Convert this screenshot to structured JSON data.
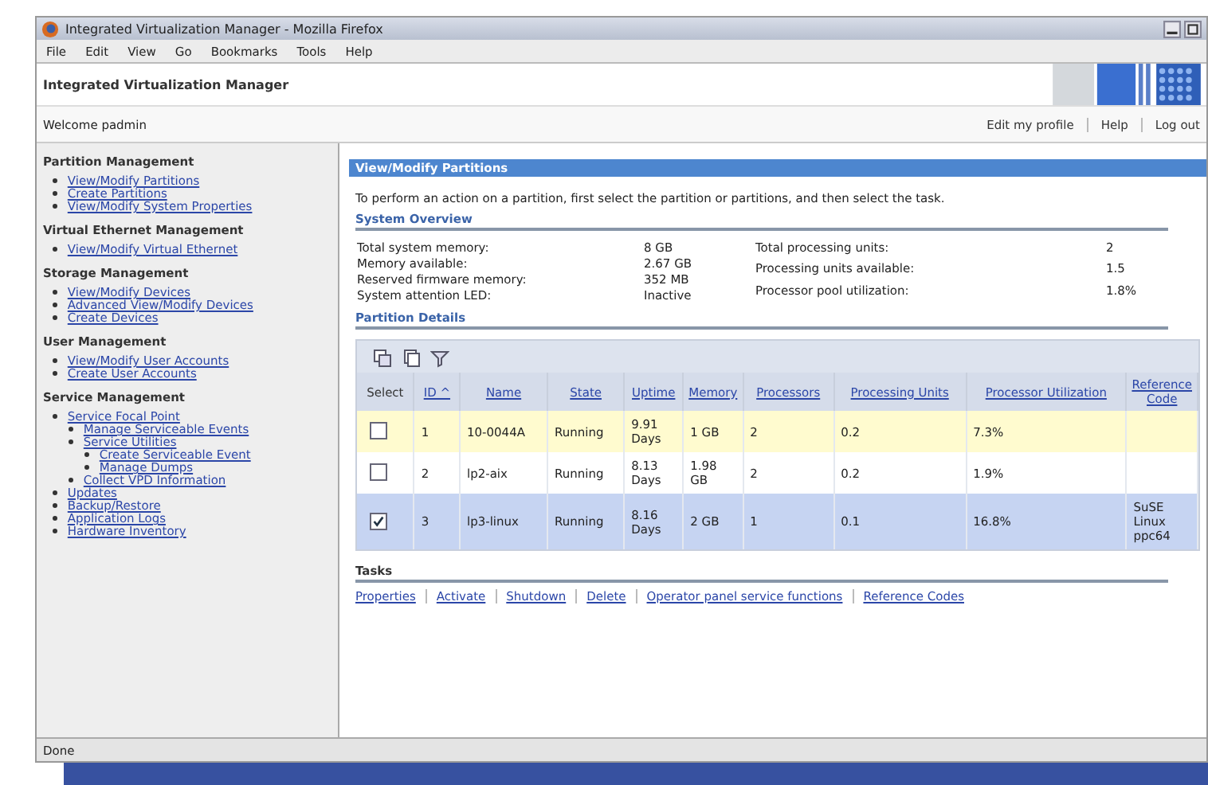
{
  "window": {
    "title": "Integrated Virtualization Manager - Mozilla Firefox"
  },
  "menu": [
    "File",
    "Edit",
    "View",
    "Go",
    "Bookmarks",
    "Tools",
    "Help"
  ],
  "app_header": {
    "title": "Integrated Virtualization Manager"
  },
  "welcome": "Welcome padmin",
  "user_links": [
    "Edit my profile",
    "Help",
    "Log out"
  ],
  "sidebar": {
    "sections": [
      {
        "title": "Partition Management",
        "items": [
          {
            "label": "View/Modify Partitions"
          },
          {
            "label": "Create Partitions"
          },
          {
            "label": "View/Modify System Properties"
          }
        ]
      },
      {
        "title": "Virtual Ethernet Management",
        "items": [
          {
            "label": "View/Modify Virtual Ethernet"
          }
        ]
      },
      {
        "title": "Storage Management",
        "items": [
          {
            "label": "View/Modify Devices"
          },
          {
            "label": "Advanced View/Modify Devices"
          },
          {
            "label": "Create Devices"
          }
        ]
      },
      {
        "title": "User Management",
        "items": [
          {
            "label": "View/Modify User Accounts"
          },
          {
            "label": "Create User Accounts"
          }
        ]
      },
      {
        "title": "Service Management",
        "items": [
          {
            "label": "Service Focal Point",
            "children": [
              {
                "label": "Manage Serviceable Events"
              },
              {
                "label": "Service Utilities",
                "children": [
                  {
                    "label": "Create Serviceable Event"
                  },
                  {
                    "label": "Manage Dumps"
                  }
                ]
              },
              {
                "label": "Collect VPD Information"
              }
            ]
          },
          {
            "label": "Updates"
          },
          {
            "label": "Backup/Restore"
          },
          {
            "label": "Application Logs"
          },
          {
            "label": "Hardware Inventory"
          }
        ]
      }
    ]
  },
  "panel": {
    "title": "View/Modify Partitions",
    "instructions": "To perform an action on a partition, first select the partition or partitions, and then select the task.",
    "overview_title": "System Overview",
    "overview_left": [
      {
        "label": "Total system memory:",
        "value": "8 GB"
      },
      {
        "label": "Memory available:",
        "value": "2.67 GB"
      },
      {
        "label": "Reserved firmware memory:",
        "value": "352 MB"
      },
      {
        "label": "System attention LED:",
        "value": "Inactive"
      }
    ],
    "overview_right": [
      {
        "label": "Total processing units:",
        "value": "2"
      },
      {
        "label": "Processing units available:",
        "value": "1.5"
      },
      {
        "label": "Processor pool utilization:",
        "value": "1.8%"
      }
    ],
    "details_title": "Partition Details"
  },
  "table": {
    "columns": [
      "Select",
      "ID ^",
      "Name",
      "State",
      "Uptime",
      "Memory",
      "Processors",
      "Processing Units",
      "Processor Utilization",
      "Reference Code"
    ],
    "rows": [
      {
        "selected": false,
        "highlighted": true,
        "cells": [
          "",
          "1",
          "10-0044A",
          "Running",
          "9.91 Days",
          "1 GB",
          "2",
          "0.2",
          "7.3%",
          ""
        ]
      },
      {
        "selected": false,
        "highlighted": false,
        "cells": [
          "",
          "2",
          "lp2-aix",
          "Running",
          "8.13 Days",
          "1.98 GB",
          "2",
          "0.2",
          "1.9%",
          ""
        ]
      },
      {
        "selected": true,
        "highlighted": false,
        "cells": [
          "",
          "3",
          "lp3-linux",
          "Running",
          "8.16 Days",
          "2 GB",
          "1",
          "0.1",
          "16.8%",
          "SuSE Linux ppc64"
        ]
      }
    ]
  },
  "tasks": {
    "title": "Tasks",
    "links": [
      "Properties",
      "Activate",
      "Shutdown",
      "Delete",
      "Operator panel service functions",
      "Reference Codes"
    ]
  },
  "status_bar": "Done"
}
